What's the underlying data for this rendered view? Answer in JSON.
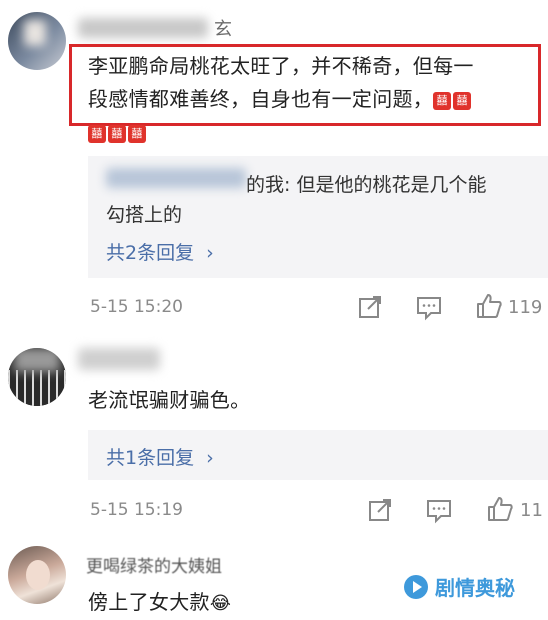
{
  "comment1": {
    "name_suffix": "玄",
    "text_line1": "李亚鹏命局桃花太旺了，并不稀奇，但每一",
    "text_line2": "段感情都难善终，自身也有一定问题，",
    "emoji_glyph": "囍",
    "reply_preview_suffix": "的我: 但是他的桃花是几个能",
    "reply_preview_line2": "勾搭上的",
    "reply_more": "共2条回复",
    "time": "5-15 15:20",
    "likes": "119"
  },
  "comment2": {
    "text": "老流氓骗财骗色。",
    "reply_more": "共1条回复",
    "time": "5-15 15:19",
    "likes": "11"
  },
  "comment3": {
    "name": "更喝绿茶的大姨姐",
    "text": "傍上了女大款",
    "emoji": "😂"
  },
  "watermark": {
    "text": "剧情奥秘"
  },
  "colors": {
    "highlight_box": "#d8282a",
    "link": "#4a6ea8",
    "emoji_red": "#e0332c",
    "watermark_blue": "#2a8fd8"
  },
  "icons": [
    "share-icon",
    "comment-icon",
    "like-icon",
    "chevron-right-icon"
  ]
}
